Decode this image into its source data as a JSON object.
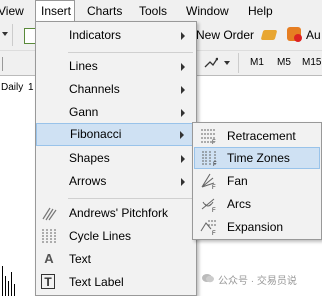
{
  "menubar": {
    "items": [
      {
        "label": "View"
      },
      {
        "label": "Insert"
      },
      {
        "label": "Charts"
      },
      {
        "label": "Tools"
      },
      {
        "label": "Window"
      },
      {
        "label": "Help"
      }
    ]
  },
  "toolbar": {
    "new_order": "New Order",
    "autotrading": "Au",
    "timeframes": [
      "M1",
      "M5",
      "M15"
    ]
  },
  "chart": {
    "tab_label": "Daily"
  },
  "insert_menu": {
    "items": [
      {
        "label": "Indicators",
        "submenu": true,
        "icon": ""
      },
      {
        "label": "Lines",
        "submenu": true,
        "icon": ""
      },
      {
        "label": "Channels",
        "submenu": true,
        "icon": ""
      },
      {
        "label": "Gann",
        "submenu": true,
        "icon": ""
      },
      {
        "label": "Fibonacci",
        "submenu": true,
        "icon": ""
      },
      {
        "label": "Shapes",
        "submenu": true,
        "icon": ""
      },
      {
        "label": "Arrows",
        "submenu": true,
        "icon": ""
      },
      {
        "label": "Andrews' Pitchfork",
        "submenu": false,
        "icon": "pitchfork-icon"
      },
      {
        "label": "Cycle Lines",
        "submenu": false,
        "icon": "cycle-lines-icon"
      },
      {
        "label": "Text",
        "submenu": false,
        "icon": "text-icon",
        "icon_glyph": "A"
      },
      {
        "label": "Text Label",
        "submenu": false,
        "icon": "text-label-icon",
        "icon_glyph": "T"
      }
    ],
    "highlighted": "Fibonacci"
  },
  "fibonacci_submenu": {
    "items": [
      {
        "label": "Retracement",
        "icon": "fibo-retracement-icon"
      },
      {
        "label": "Time Zones",
        "icon": "fibo-timezones-icon"
      },
      {
        "label": "Fan",
        "icon": "fibo-fan-icon"
      },
      {
        "label": "Arcs",
        "icon": "fibo-arcs-icon"
      },
      {
        "label": "Expansion",
        "icon": "fibo-expansion-icon"
      }
    ],
    "highlighted": "Time Zones"
  },
  "watermark": {
    "text": "公众号 · 交易员说"
  },
  "colors": {
    "highlight_bg": "#cfe1f3",
    "highlight_border": "#99c3ea",
    "menu_bg": "#f2f2f2",
    "bar_bg": "#f0f0f0"
  }
}
